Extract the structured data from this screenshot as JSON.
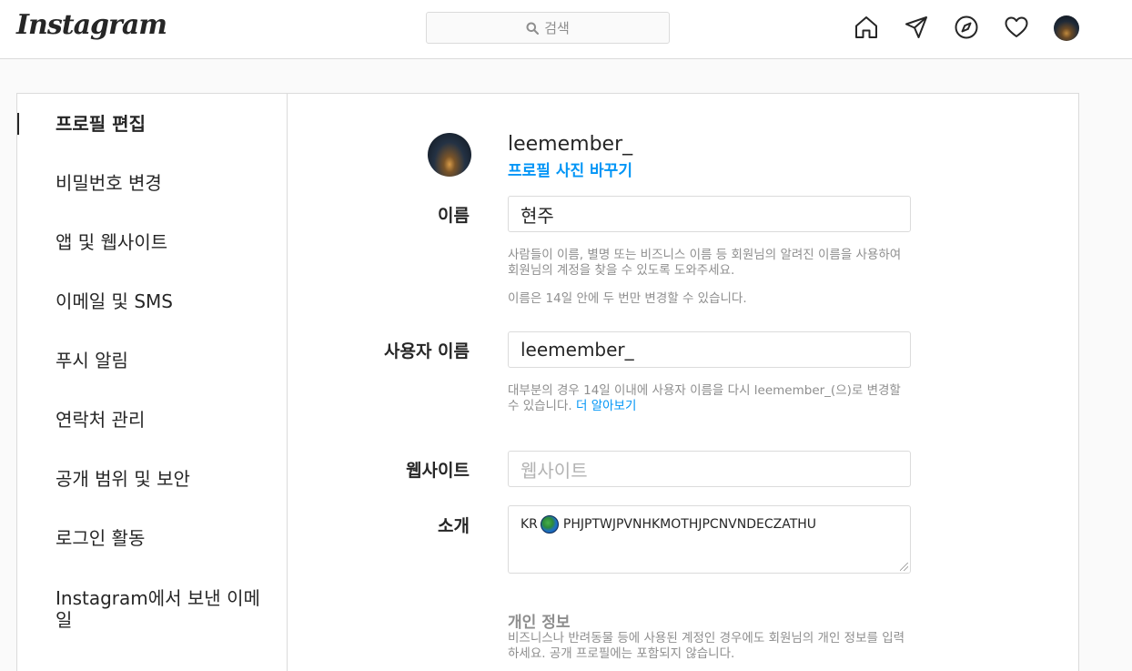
{
  "header": {
    "logo": "Instagram",
    "search_placeholder": "검색",
    "nav_icons": [
      "home-icon",
      "direct-icon",
      "explore-icon",
      "activity-heart-icon",
      "profile-avatar"
    ]
  },
  "sidebar": {
    "items": [
      {
        "label": "프로필 편집",
        "active": true
      },
      {
        "label": "비밀번호 변경"
      },
      {
        "label": "앱 및 웹사이트"
      },
      {
        "label": "이메일 및 SMS"
      },
      {
        "label": "푸시 알림"
      },
      {
        "label": "연락처 관리"
      },
      {
        "label": "공개 범위 및 보안"
      },
      {
        "label": "로그인 활동"
      },
      {
        "label": "Instagram에서 보낸 이메일"
      }
    ]
  },
  "profile": {
    "username": "leemember_",
    "change_photo": "프로필 사진 바꾸기"
  },
  "form": {
    "name": {
      "label": "이름",
      "value": "현주",
      "help1": "사람들이 이름, 별명 또는 비즈니스 이름 등 회원님의 알려진 이름을 사용하여 회원님의 계정을 찾을 수 있도록 도와주세요.",
      "help2": "이름은 14일 안에 두 번만 변경할 수 있습니다."
    },
    "username": {
      "label": "사용자 이름",
      "value": "leemember_",
      "help": "대부분의 경우 14일 이내에 사용자 이름을 다시 leemember_(으)로 변경할 수 있습니다.",
      "learn_more": "더 알아보기"
    },
    "website": {
      "label": "웹사이트",
      "placeholder": "웹사이트"
    },
    "bio": {
      "label": "소개",
      "prefix": "KR",
      "suffix": "PHJPTWJPVNHKMOTHJPCNVNDECZATHU"
    },
    "personal_info": {
      "title": "개인 정보",
      "help": "비즈니스나 반려동물 등에 사용된 계정인 경우에도 회원님의 개인 정보를 입력하세요. 공개 프로필에는 포함되지 않습니다."
    }
  },
  "colors": {
    "accent": "#0095f6",
    "border": "#dbdbdb",
    "muted_text": "#8e8e8e"
  }
}
